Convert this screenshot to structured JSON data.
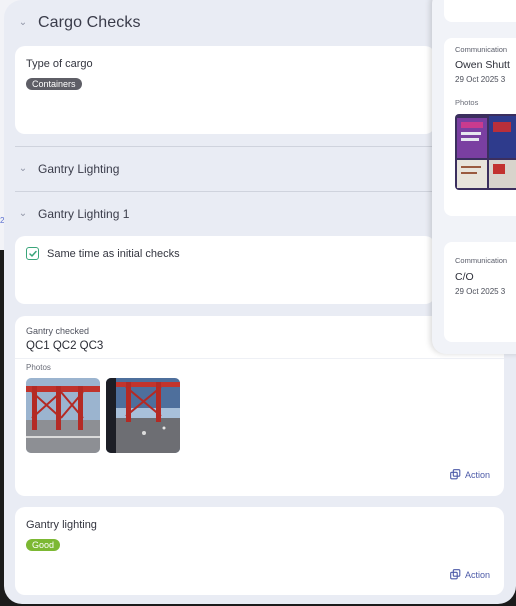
{
  "section": {
    "title": "Cargo Checks"
  },
  "cargo": {
    "label": "Type of cargo",
    "badge": "Containers",
    "badge_color": "#5e5e66"
  },
  "gantry_lighting": {
    "title": "Gantry Lighting"
  },
  "gantry_lighting_1": {
    "title": "Gantry Lighting 1"
  },
  "same_time": {
    "label": "Same time as initial checks",
    "checked": true,
    "check_color": "#3aa57a"
  },
  "gantry_checked": {
    "label": "Gantry checked",
    "value": "QC1 QC2 QC3",
    "photos_label": "Photos",
    "photos": [
      "crane-photo-1",
      "crane-photo-2"
    ],
    "action_label": "Action"
  },
  "gantry_lighting_card": {
    "label": "Gantry lighting",
    "badge": "Good",
    "badge_color": "#7cb833",
    "action_label": "Action"
  },
  "side_panel": {
    "cards": [
      {
        "type": "Communication",
        "name": "Owen Shutt",
        "date": "29 Oct 2025 3",
        "photos_label": "Photos",
        "photo": "document-photo"
      },
      {
        "type": "Communication",
        "name": "C/O",
        "date": "29 Oct 2025 3"
      }
    ]
  },
  "left_fragment": "2",
  "colors": {
    "accent": "#4c5aa8",
    "panel_bg": "#e9ecf4",
    "card_bg": "#ffffff"
  }
}
